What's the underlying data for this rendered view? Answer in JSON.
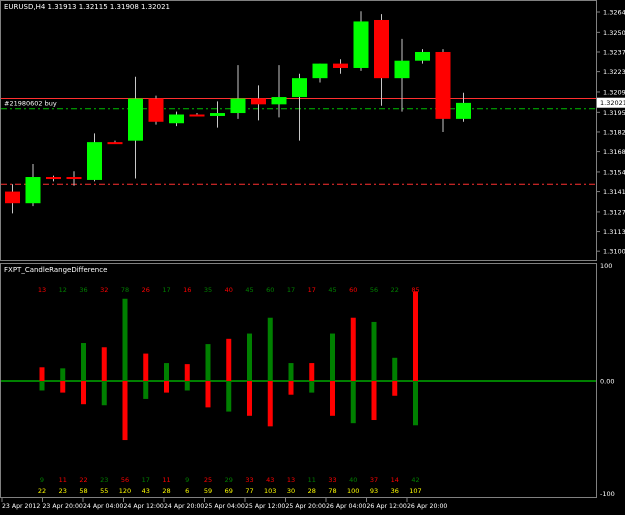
{
  "window": {
    "main_title": "EURUSD,H4  1.31913 1.32115 1.31908 1.32021",
    "indicator_title": "FXPT_CandleRangeDifference"
  },
  "price_panel": {
    "order_label": "#21980602 buy",
    "current_price": "1.32021",
    "price_ticks": [
      "1.32645",
      "1.32505",
      "1.32370",
      "1.32235",
      "1.32095",
      "1.31955",
      "1.31820",
      "1.31685",
      "1.31545",
      "1.31410",
      "1.31270",
      "1.31135",
      "1.31000"
    ],
    "levels": {
      "top_red_line": 1.3205,
      "order_line": 1.3198,
      "bottom_red_line": 1.3146
    },
    "price_range": [
      1.3096,
      1.327
    ]
  },
  "indicator_panel": {
    "scale_ticks": [
      "100",
      "0.00",
      "-100"
    ],
    "top_numbers": [
      "13",
      "12",
      "36",
      "32",
      "78",
      "26",
      "17",
      "16",
      "35",
      "40",
      "45",
      "60",
      "17",
      "17",
      "45",
      "60",
      "56",
      "22",
      "85"
    ],
    "bottom_numbers_1": [
      "9",
      "11",
      "22",
      "23",
      "56",
      "17",
      "11",
      "9",
      "25",
      "29",
      "33",
      "43",
      "13",
      "11",
      "33",
      "40",
      "37",
      "14",
      "42"
    ],
    "bottom_numbers_2": [
      "22",
      "23",
      "58",
      "55",
      "120",
      "43",
      "28",
      "6",
      "59",
      "69",
      "77",
      "103",
      "30",
      "28",
      "78",
      "100",
      "93",
      "36",
      "107"
    ],
    "top_number_colors": [
      "red",
      "green",
      "green",
      "red",
      "green",
      "red",
      "green",
      "red",
      "green",
      "red",
      "green",
      "green",
      "green",
      "red",
      "green",
      "red",
      "green",
      "green",
      "red"
    ]
  },
  "time_axis": {
    "labels": [
      "23 Apr 2012",
      "23 Apr 20:00",
      "24 Apr 04:00",
      "24 Apr 12:00",
      "24 Apr 20:00",
      "25 Apr 04:00",
      "25 Apr 12:00",
      "25 Apr 20:00",
      "26 Apr 04:00",
      "26 Apr 12:00",
      "26 Apr 20:00"
    ]
  },
  "colors": {
    "bull": "#00ff00",
    "bear": "#ff0000",
    "indicator_green": "#008000",
    "zero_line": "#00ff00",
    "axis": "#808080",
    "text_yellow": "#ffff00"
  },
  "chart_data": {
    "type": "candlestick",
    "candles": [
      {
        "o": 1.3141,
        "h": 1.3146,
        "l": 1.3126,
        "c": 1.3133,
        "dir": "bear"
      },
      {
        "o": 1.3133,
        "h": 1.316,
        "l": 1.3131,
        "c": 1.3151,
        "dir": "bull"
      },
      {
        "o": 1.3151,
        "h": 1.3152,
        "l": 1.3148,
        "c": 1.315,
        "dir": "bear"
      },
      {
        "o": 1.315,
        "h": 1.3155,
        "l": 1.3145,
        "c": 1.3151,
        "dir": "bear"
      },
      {
        "o": 1.3149,
        "h": 1.3181,
        "l": 1.3148,
        "c": 1.3175,
        "dir": "bull"
      },
      {
        "o": 1.3175,
        "h": 1.3176,
        "l": 1.3174,
        "c": 1.3174,
        "dir": "bear"
      },
      {
        "o": 1.3176,
        "h": 1.322,
        "l": 1.315,
        "c": 1.3205,
        "dir": "bull"
      },
      {
        "o": 1.3205,
        "h": 1.3207,
        "l": 1.3187,
        "c": 1.3189,
        "dir": "bear"
      },
      {
        "o": 1.3188,
        "h": 1.3196,
        "l": 1.3186,
        "c": 1.3194,
        "dir": "bull"
      },
      {
        "o": 1.3194,
        "h": 1.3195,
        "l": 1.3193,
        "c": 1.3194,
        "dir": "bear"
      },
      {
        "o": 1.3193,
        "h": 1.3203,
        "l": 1.3185,
        "c": 1.3195,
        "dir": "bull"
      },
      {
        "o": 1.3195,
        "h": 1.3228,
        "l": 1.3191,
        "c": 1.3205,
        "dir": "bull"
      },
      {
        "o": 1.3205,
        "h": 1.3214,
        "l": 1.319,
        "c": 1.3201,
        "dir": "bear"
      },
      {
        "o": 1.3201,
        "h": 1.3228,
        "l": 1.3192,
        "c": 1.3206,
        "dir": "bull"
      },
      {
        "o": 1.3206,
        "h": 1.3222,
        "l": 1.3176,
        "c": 1.3219,
        "dir": "bull"
      },
      {
        "o": 1.3219,
        "h": 1.3229,
        "l": 1.3216,
        "c": 1.3229,
        "dir": "bull"
      },
      {
        "o": 1.3229,
        "h": 1.3232,
        "l": 1.3222,
        "c": 1.3226,
        "dir": "bear"
      },
      {
        "o": 1.3226,
        "h": 1.3265,
        "l": 1.3224,
        "c": 1.3258,
        "dir": "bull"
      },
      {
        "o": 1.3259,
        "h": 1.3263,
        "l": 1.32,
        "c": 1.3219,
        "dir": "bear"
      },
      {
        "o": 1.3219,
        "h": 1.3246,
        "l": 1.3196,
        "c": 1.3231,
        "dir": "bull"
      },
      {
        "o": 1.3231,
        "h": 1.3239,
        "l": 1.3229,
        "c": 1.3237,
        "dir": "bull"
      },
      {
        "o": 1.3237,
        "h": 1.3239,
        "l": 1.3182,
        "c": 1.3191,
        "dir": "bear"
      },
      {
        "o": 1.3191,
        "h": 1.3209,
        "l": 1.3189,
        "c": 1.3202,
        "dir": "bull"
      }
    ],
    "indicator_bars": [
      {
        "up": 13,
        "up_color": "red",
        "down": 9,
        "down_color": "green"
      },
      {
        "up": 12,
        "up_color": "green",
        "down": 11,
        "down_color": "red"
      },
      {
        "up": 36,
        "up_color": "green",
        "down": 22,
        "down_color": "red"
      },
      {
        "up": 32,
        "up_color": "red",
        "down": 23,
        "down_color": "green"
      },
      {
        "up": 78,
        "up_color": "green",
        "down": 56,
        "down_color": "red"
      },
      {
        "up": 26,
        "up_color": "red",
        "down": 17,
        "down_color": "green"
      },
      {
        "up": 17,
        "up_color": "green",
        "down": 11,
        "down_color": "red"
      },
      {
        "up": 16,
        "up_color": "red",
        "down": 9,
        "down_color": "green"
      },
      {
        "up": 35,
        "up_color": "green",
        "down": 25,
        "down_color": "red"
      },
      {
        "up": 40,
        "up_color": "red",
        "down": 29,
        "down_color": "green"
      },
      {
        "up": 45,
        "up_color": "green",
        "down": 33,
        "down_color": "red"
      },
      {
        "up": 60,
        "up_color": "green",
        "down": 43,
        "down_color": "red"
      },
      {
        "up": 17,
        "up_color": "green",
        "down": 13,
        "down_color": "red"
      },
      {
        "up": 17,
        "up_color": "red",
        "down": 11,
        "down_color": "green"
      },
      {
        "up": 45,
        "up_color": "green",
        "down": 33,
        "down_color": "red"
      },
      {
        "up": 60,
        "up_color": "red",
        "down": 40,
        "down_color": "green"
      },
      {
        "up": 56,
        "up_color": "green",
        "down": 37,
        "down_color": "red"
      },
      {
        "up": 22,
        "up_color": "green",
        "down": 14,
        "down_color": "red"
      },
      {
        "up": 85,
        "up_color": "red",
        "down": 42,
        "down_color": "green"
      }
    ],
    "indicator_ylim": [
      -100,
      100
    ]
  }
}
